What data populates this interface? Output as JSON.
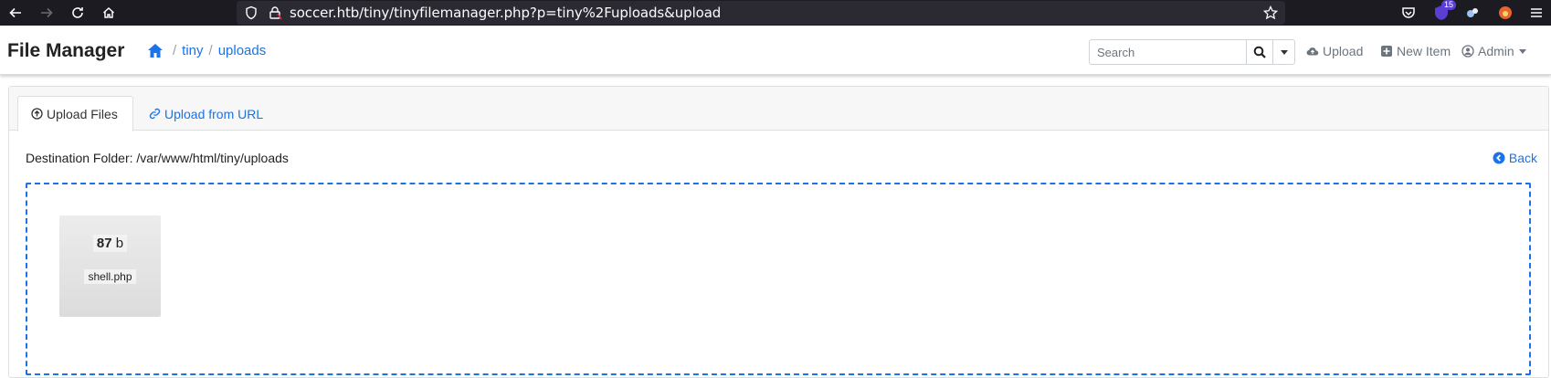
{
  "browser": {
    "url": "soccer.htb/tiny/tinyfilemanager.php?p=tiny%2Fuploads&upload",
    "extension_badge": "15"
  },
  "navbar": {
    "brand": "File Manager",
    "breadcrumbs": [
      "tiny",
      "uploads"
    ],
    "breadcrumb_separator": "/",
    "search_placeholder": "Search",
    "upload_label": "Upload",
    "new_item_label": "New Item",
    "admin_label": "Admin"
  },
  "tabs": {
    "upload_files": "Upload Files",
    "upload_from_url": "Upload from URL"
  },
  "content": {
    "destination": "Destination Folder: /var/www/html/tiny/uploads",
    "back_label": "Back"
  },
  "file_preview": {
    "size_value": "87",
    "size_unit": "b",
    "filename": "shell.php"
  },
  "colors": {
    "accent": "#1a73e8",
    "browser_bg": "#1c1b22"
  }
}
